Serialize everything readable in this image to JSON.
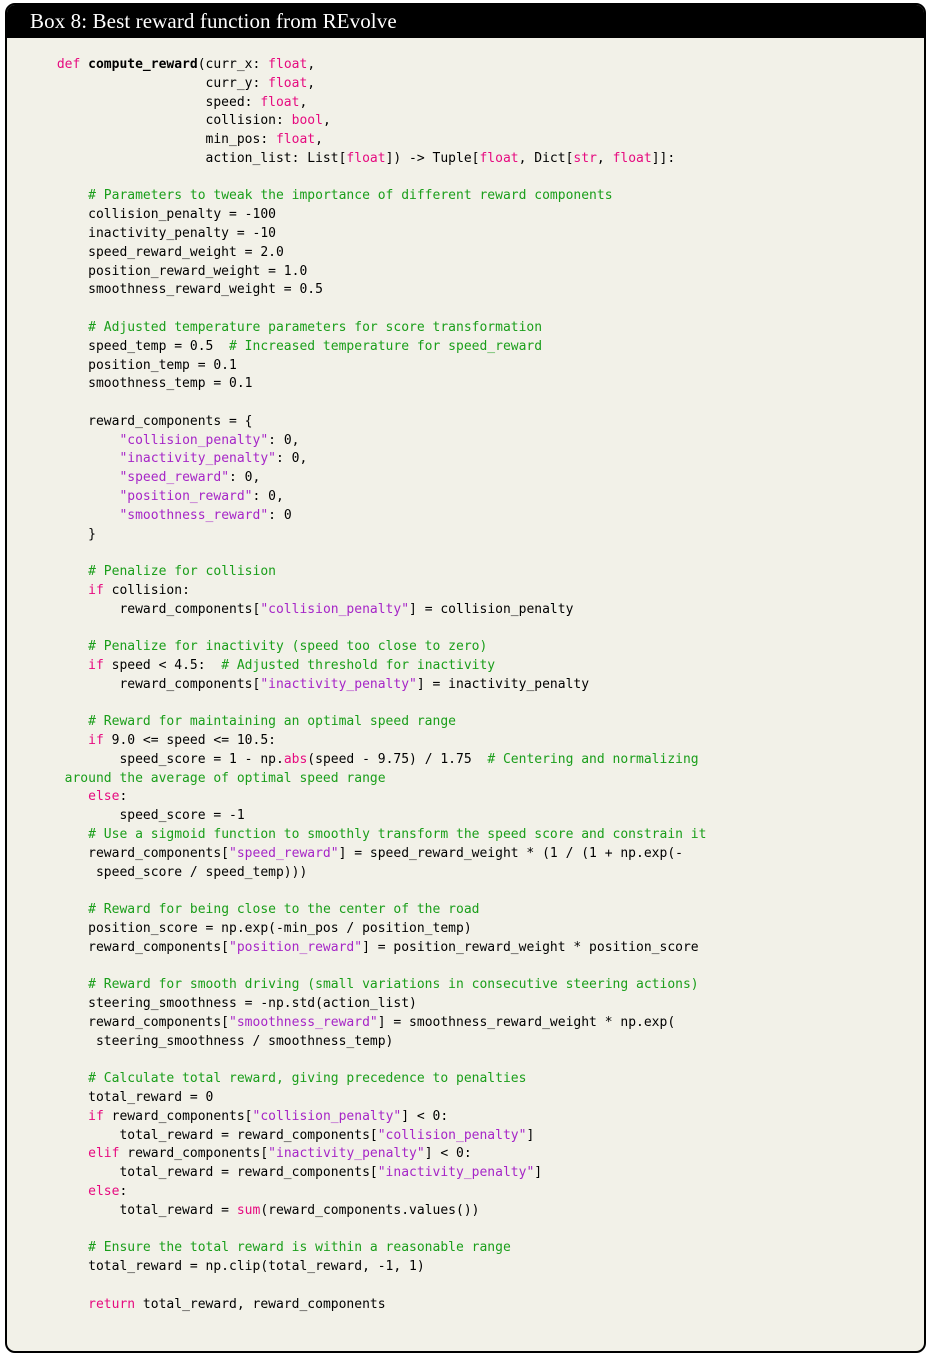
{
  "box": {
    "title": "Box 8: Best reward function from REvolve",
    "header_bg": "#000000",
    "header_fg": "#ffffff",
    "body_bg": "#f2f1e8",
    "border_color": "#000000"
  },
  "syntax_colors": {
    "keyword": "#e60a7f",
    "type": "#e60a7f",
    "builtin": "#e60a7f",
    "string": "#a626c7",
    "comment": "#1a9e1a",
    "text": "#000000",
    "function_name": "#000000"
  },
  "code": {
    "language": "python",
    "lines": [
      {
        "id": 1,
        "text": " def compute_reward(curr_x: float,"
      },
      {
        "id": 2,
        "text": "                    curr_y: float,"
      },
      {
        "id": 3,
        "text": "                    speed: float,"
      },
      {
        "id": 4,
        "text": "                    collision: bool,"
      },
      {
        "id": 5,
        "text": "                    min_pos: float,"
      },
      {
        "id": 6,
        "text": "                    action_list: List[float]) -> Tuple[float, Dict[str, float]]:"
      },
      {
        "id": 7,
        "text": ""
      },
      {
        "id": 8,
        "text": "     # Parameters to tweak the importance of different reward components"
      },
      {
        "id": 9,
        "text": "     collision_penalty = -100"
      },
      {
        "id": 10,
        "text": "     inactivity_penalty = -10"
      },
      {
        "id": 11,
        "text": "     speed_reward_weight = 2.0"
      },
      {
        "id": 12,
        "text": "     position_reward_weight = 1.0"
      },
      {
        "id": 13,
        "text": "     smoothness_reward_weight = 0.5"
      },
      {
        "id": 14,
        "text": ""
      },
      {
        "id": 15,
        "text": "     # Adjusted temperature parameters for score transformation"
      },
      {
        "id": 16,
        "text": "     speed_temp = 0.5  # Increased temperature for speed_reward"
      },
      {
        "id": 17,
        "text": "     position_temp = 0.1"
      },
      {
        "id": 18,
        "text": "     smoothness_temp = 0.1"
      },
      {
        "id": 19,
        "text": ""
      },
      {
        "id": 20,
        "text": "     reward_components = {"
      },
      {
        "id": 21,
        "text": "         \"collision_penalty\": 0,"
      },
      {
        "id": 22,
        "text": "         \"inactivity_penalty\": 0,"
      },
      {
        "id": 23,
        "text": "         \"speed_reward\": 0,"
      },
      {
        "id": 24,
        "text": "         \"position_reward\": 0,"
      },
      {
        "id": 25,
        "text": "         \"smoothness_reward\": 0"
      },
      {
        "id": 26,
        "text": "     }"
      },
      {
        "id": 27,
        "text": ""
      },
      {
        "id": 28,
        "text": "     # Penalize for collision"
      },
      {
        "id": 29,
        "text": "     if collision:"
      },
      {
        "id": 30,
        "text": "         reward_components[\"collision_penalty\"] = collision_penalty"
      },
      {
        "id": 31,
        "text": ""
      },
      {
        "id": 32,
        "text": "     # Penalize for inactivity (speed too close to zero)"
      },
      {
        "id": 33,
        "text": "     if speed < 4.5:  # Adjusted threshold for inactivity"
      },
      {
        "id": 34,
        "text": "         reward_components[\"inactivity_penalty\"] = inactivity_penalty"
      },
      {
        "id": 35,
        "text": ""
      },
      {
        "id": 36,
        "text": "     # Reward for maintaining an optimal speed range"
      },
      {
        "id": 37,
        "text": "     if 9.0 <= speed <= 10.5:"
      },
      {
        "id": 38,
        "text": "         speed_score = 1 - np.abs(speed - 9.75) / 1.75  # Centering and normalizing"
      },
      {
        "id": 39,
        "text": "  around the average of optimal speed range"
      },
      {
        "id": 40,
        "text": "     else:"
      },
      {
        "id": 41,
        "text": "         speed_score = -1"
      },
      {
        "id": 42,
        "text": "     # Use a sigmoid function to smoothly transform the speed score and constrain it"
      },
      {
        "id": 43,
        "text": "     reward_components[\"speed_reward\"] = speed_reward_weight * (1 / (1 + np.exp(-"
      },
      {
        "id": 44,
        "text": "      speed_score / speed_temp)))"
      },
      {
        "id": 45,
        "text": ""
      },
      {
        "id": 46,
        "text": "     # Reward for being close to the center of the road"
      },
      {
        "id": 47,
        "text": "     position_score = np.exp(-min_pos / position_temp)"
      },
      {
        "id": 48,
        "text": "     reward_components[\"position_reward\"] = position_reward_weight * position_score"
      },
      {
        "id": 49,
        "text": ""
      },
      {
        "id": 50,
        "text": "     # Reward for smooth driving (small variations in consecutive steering actions)"
      },
      {
        "id": 51,
        "text": "     steering_smoothness = -np.std(action_list)"
      },
      {
        "id": 52,
        "text": "     reward_components[\"smoothness_reward\"] = smoothness_reward_weight * np.exp("
      },
      {
        "id": 53,
        "text": "      steering_smoothness / smoothness_temp)"
      },
      {
        "id": 54,
        "text": ""
      },
      {
        "id": 55,
        "text": "     # Calculate total reward, giving precedence to penalties"
      },
      {
        "id": 56,
        "text": "     total_reward = 0"
      },
      {
        "id": 57,
        "text": "     if reward_components[\"collision_penalty\"] < 0:"
      },
      {
        "id": 58,
        "text": "         total_reward = reward_components[\"collision_penalty\"]"
      },
      {
        "id": 59,
        "text": "     elif reward_components[\"inactivity_penalty\"] < 0:"
      },
      {
        "id": 60,
        "text": "         total_reward = reward_components[\"inactivity_penalty\"]"
      },
      {
        "id": 61,
        "text": "     else:"
      },
      {
        "id": 62,
        "text": "         total_reward = sum(reward_components.values())"
      },
      {
        "id": 63,
        "text": ""
      },
      {
        "id": 64,
        "text": "     # Ensure the total reward is within a reasonable range"
      },
      {
        "id": 65,
        "text": "     total_reward = np.clip(total_reward, -1, 1)"
      },
      {
        "id": 66,
        "text": ""
      },
      {
        "id": 67,
        "text": "     return total_reward, reward_components"
      }
    ]
  }
}
